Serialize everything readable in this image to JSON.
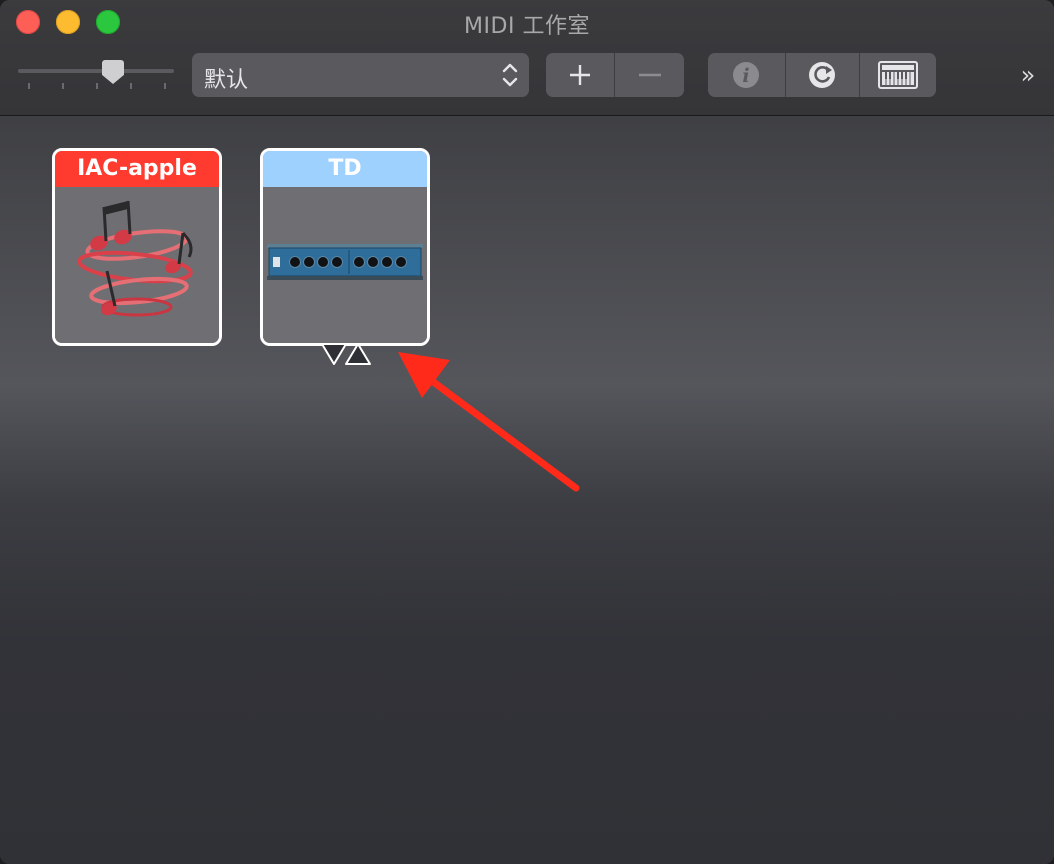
{
  "window": {
    "title": "MIDI 工作室"
  },
  "toolbar": {
    "slider_ticks": 6,
    "configuration_select": {
      "value": "默认"
    },
    "add_label": "+",
    "remove_label": "—",
    "more_label": "»"
  },
  "devices": [
    {
      "name": "IAC-apple",
      "label_color": "#ff3b30",
      "icon": "musical-notes-swirl-icon"
    },
    {
      "name": "TD",
      "label_color": "#9fd1ff",
      "icon": "midi-interface-rack-icon",
      "ports": "▽△"
    }
  ],
  "annotation": {
    "arrow_color": "#ff2a1a"
  },
  "colors": {
    "window_bg": "#2f3035",
    "toolbar_control": "#5a5a5e",
    "traffic_close": "#fd5f57",
    "traffic_min": "#fdbc2f",
    "traffic_max": "#2bc73f"
  }
}
